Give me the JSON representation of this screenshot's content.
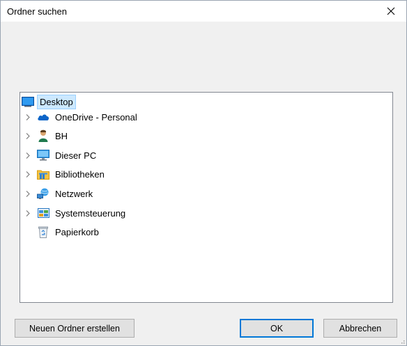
{
  "dialog": {
    "title": "Ordner suchen"
  },
  "tree": {
    "items": [
      {
        "label": "Desktop",
        "icon": "desktop-icon",
        "expandable": false,
        "selected": true
      },
      {
        "label": "OneDrive - Personal",
        "icon": "onedrive-cloud-icon",
        "expandable": true
      },
      {
        "label": "BH",
        "icon": "user-icon",
        "expandable": true
      },
      {
        "label": "Dieser PC",
        "icon": "monitor-icon",
        "expandable": true
      },
      {
        "label": "Bibliotheken",
        "icon": "library-folder-icon",
        "expandable": true
      },
      {
        "label": "Netzwerk",
        "icon": "network-icon",
        "expandable": true
      },
      {
        "label": "Systemsteuerung",
        "icon": "control-panel-icon",
        "expandable": true
      },
      {
        "label": "Papierkorb",
        "icon": "recycle-bin-icon",
        "expandable": false
      }
    ]
  },
  "buttons": {
    "new_folder": "Neuen Ordner erstellen",
    "ok": "OK",
    "cancel": "Abbrechen"
  },
  "colors": {
    "selection": "#cce8ff",
    "accent": "#0078d7"
  }
}
